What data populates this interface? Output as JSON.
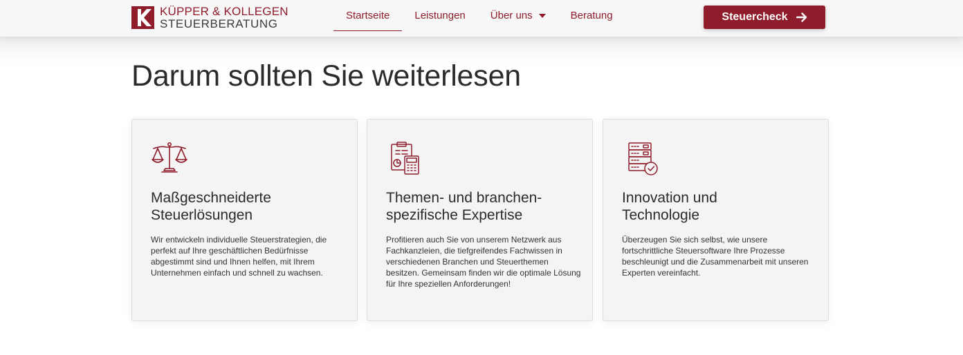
{
  "header": {
    "logo": {
      "line1": "KÜPPER & KOLLEGEN",
      "line2": "STEUERBERATUNG"
    },
    "nav": [
      {
        "label": "Startseite",
        "active": true
      },
      {
        "label": "Leistungen",
        "active": false
      },
      {
        "label": "Über uns",
        "active": false,
        "has_dropdown": true
      },
      {
        "label": "Beratung",
        "active": false
      }
    ],
    "cta": {
      "label": "Steuercheck",
      "icon": "arrow-right-icon"
    }
  },
  "main": {
    "headline": "Darum sollten Sie weiterlesen",
    "cards": [
      {
        "icon": "scales-icon",
        "title_line1": "Maßgeschneiderte",
        "title_line2": "Steuerlösungen",
        "text": "Wir entwickeln individuelle Steuerstrategien, die perfekt auf Ihre geschäftlichen Bedürfnisse abgestimmt sind und Ihnen helfen, mit Ihrem Unternehmen einfach und schnell zu wachsen."
      },
      {
        "icon": "clipboard-calculator-icon",
        "title_line1": "Themen- und branchen-",
        "title_line2": "spezifische Expertise",
        "text": "Profitieren auch Sie von unserem Netzwerk aus Fachkanzleien, die tiefgreifendes Fachwissen in verschiedenen Branchen und Steuerthemen besitzen. Gemeinsam finden wir die optimale Lösung für Ihre speziellen Anforderungen!"
      },
      {
        "icon": "server-check-icon",
        "title_line1": "Innovation und",
        "title_line2": "Technologie",
        "text": "Überzeugen Sie sich selbst, wie unsere fortschrittliche Steuersoftware Ihre Prozesse beschleunigt und die Zusammenarbeit mit unseren Experten vereinfacht."
      }
    ]
  },
  "colors": {
    "brand": "#8f1c2b",
    "header_bg": "#f7f7f7",
    "card_bg": "#f4f4f4",
    "text": "#2b2b2b"
  }
}
